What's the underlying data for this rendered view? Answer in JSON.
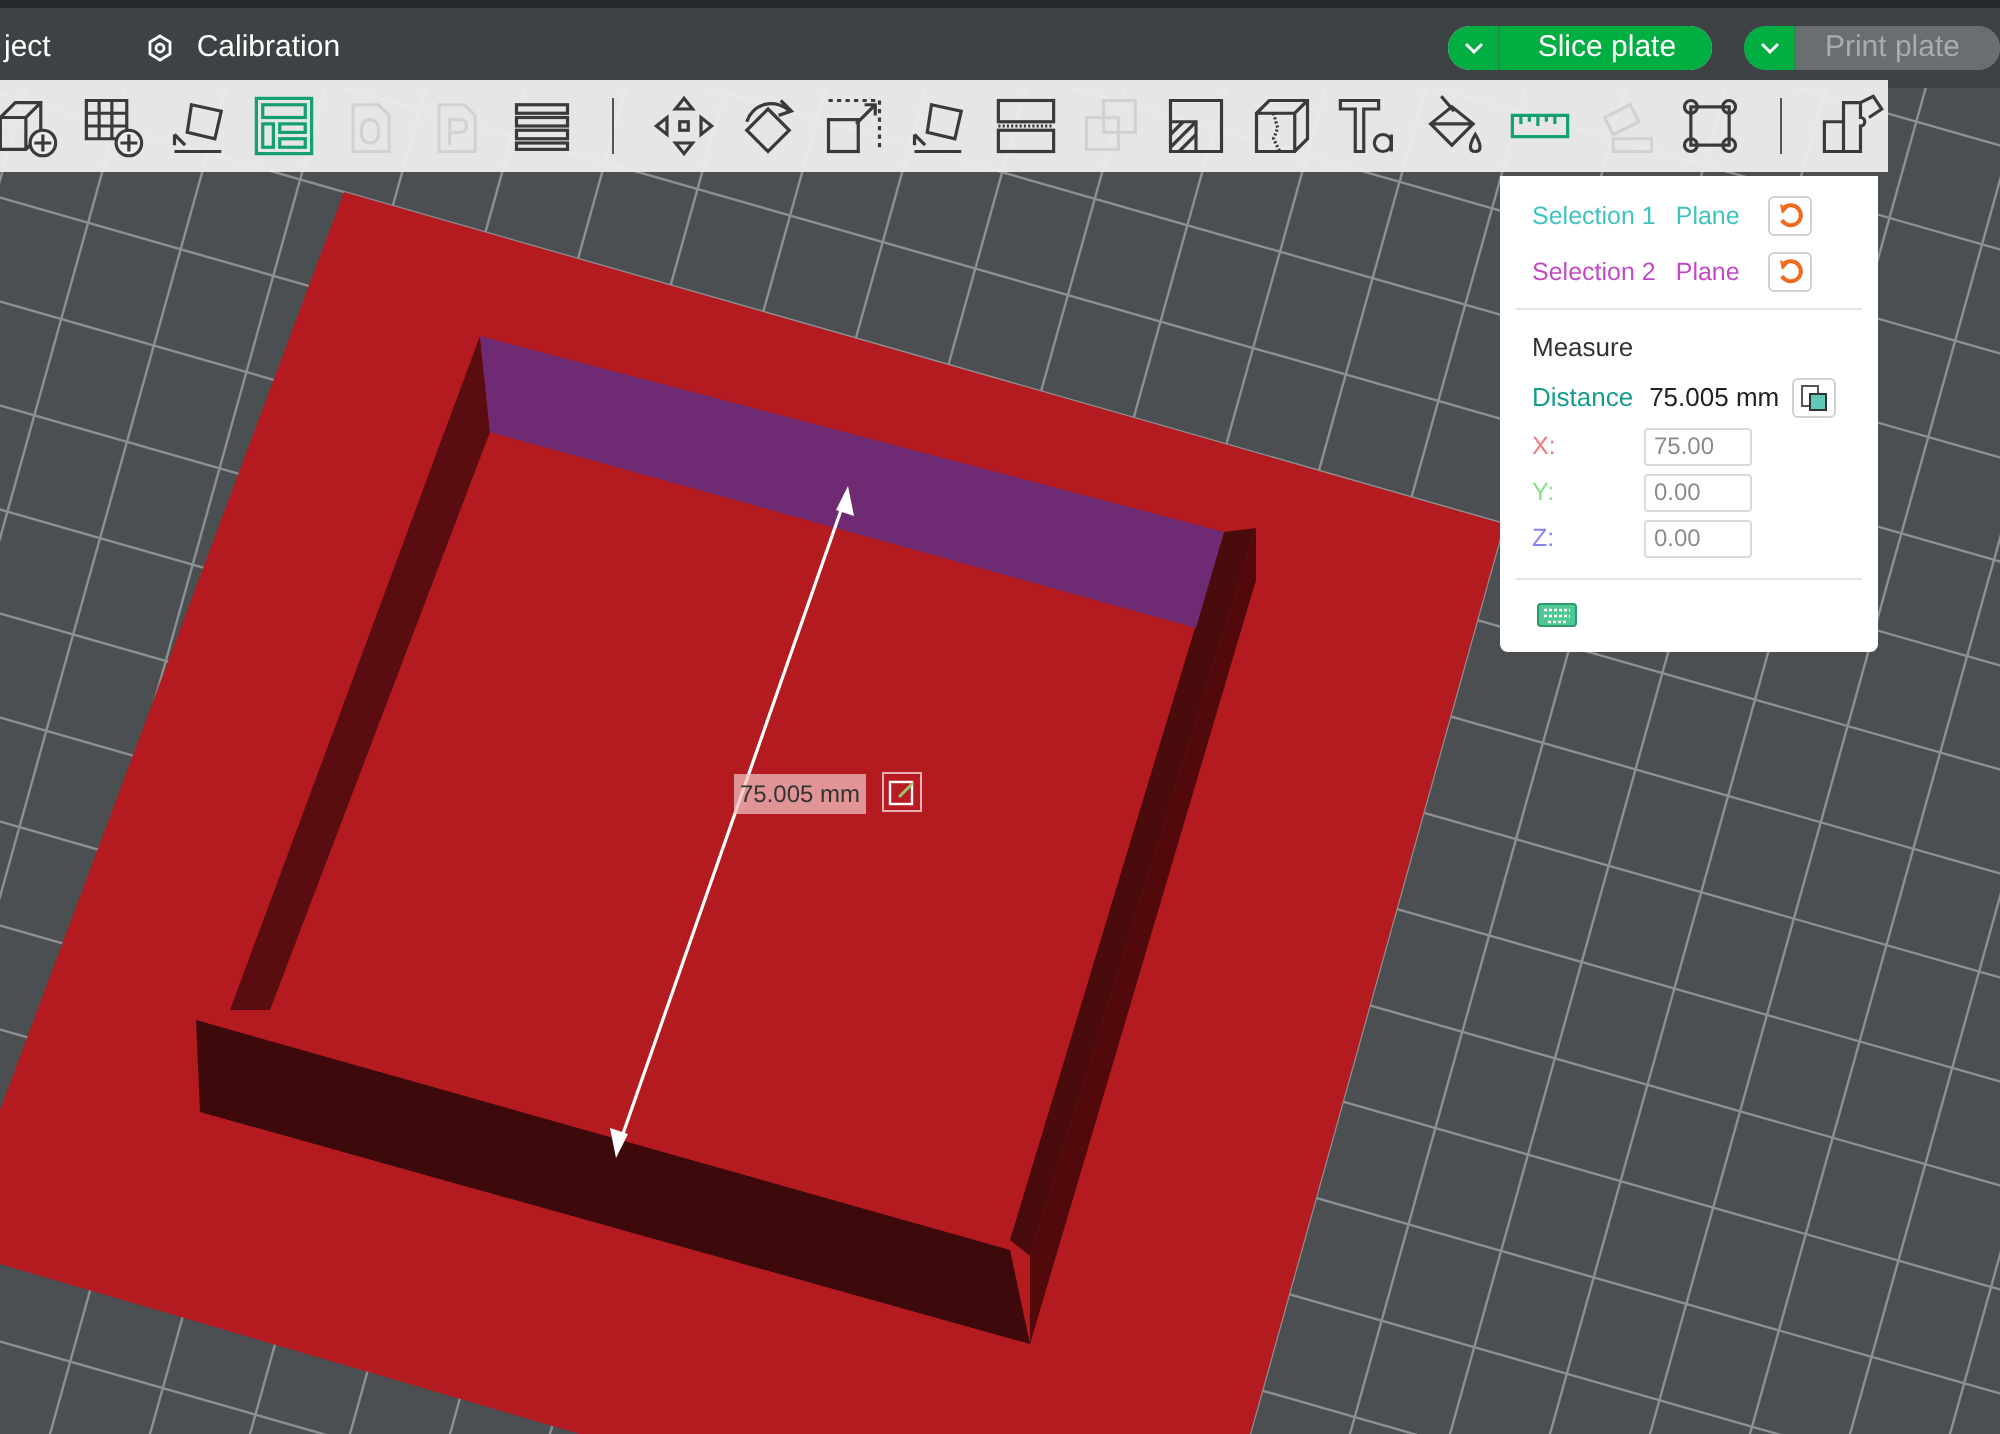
{
  "top_bar": {
    "tabs": [
      {
        "label": "ject",
        "icon": false
      },
      {
        "label": "Calibration",
        "icon": true
      }
    ],
    "actions": [
      {
        "label": "Slice plate",
        "disabled": false
      },
      {
        "label": "Print plate",
        "disabled": true
      }
    ]
  },
  "toolbar": [
    {
      "kind": "tool",
      "disabled": false,
      "selected": false
    },
    {
      "kind": "tool",
      "disabled": false,
      "selected": false
    },
    {
      "kind": "tool",
      "disabled": false,
      "selected": false
    },
    {
      "kind": "tool",
      "disabled": false,
      "selected": true
    },
    {
      "kind": "tool",
      "disabled": true,
      "selected": false
    },
    {
      "kind": "tool",
      "disabled": true,
      "selected": false
    },
    {
      "kind": "tool",
      "disabled": false,
      "selected": false
    },
    {
      "kind": "separator"
    },
    {
      "kind": "tool",
      "disabled": false,
      "selected": false
    },
    {
      "kind": "tool",
      "disabled": false,
      "selected": false
    },
    {
      "kind": "tool",
      "disabled": false,
      "selected": false
    },
    {
      "kind": "tool",
      "disabled": false,
      "selected": false
    },
    {
      "kind": "tool",
      "disabled": false,
      "selected": false
    },
    {
      "kind": "tool",
      "disabled": true,
      "selected": false
    },
    {
      "kind": "tool",
      "disabled": false,
      "selected": false
    },
    {
      "kind": "tool",
      "disabled": false,
      "selected": false
    },
    {
      "kind": "tool",
      "disabled": false,
      "selected": false
    },
    {
      "kind": "tool",
      "disabled": false,
      "selected": false
    },
    {
      "kind": "tool",
      "disabled": false,
      "selected": true
    },
    {
      "kind": "tool",
      "disabled": true,
      "selected": false
    },
    {
      "kind": "tool",
      "disabled": false,
      "selected": false
    },
    {
      "kind": "separator"
    },
    {
      "kind": "tool",
      "disabled": false,
      "selected": false
    }
  ],
  "measure_panel": {
    "selections": [
      {
        "label": "Selection 1",
        "value": "Plane",
        "color": "#3ec3c0"
      },
      {
        "label": "Selection 2",
        "value": "Plane",
        "color": "#c248c8"
      }
    ],
    "title": "Measure",
    "distance_label": "Distance",
    "distance_value": "75.005 mm",
    "axes": [
      {
        "label": "X:",
        "value": "75.00",
        "color": "#f07878"
      },
      {
        "label": "Y:",
        "value": "0.00",
        "color": "#88e088"
      },
      {
        "label": "Z:",
        "value": "0.00",
        "color": "#8a84f0"
      }
    ]
  },
  "viewport": {
    "dimension_label": "75.005 mm"
  }
}
